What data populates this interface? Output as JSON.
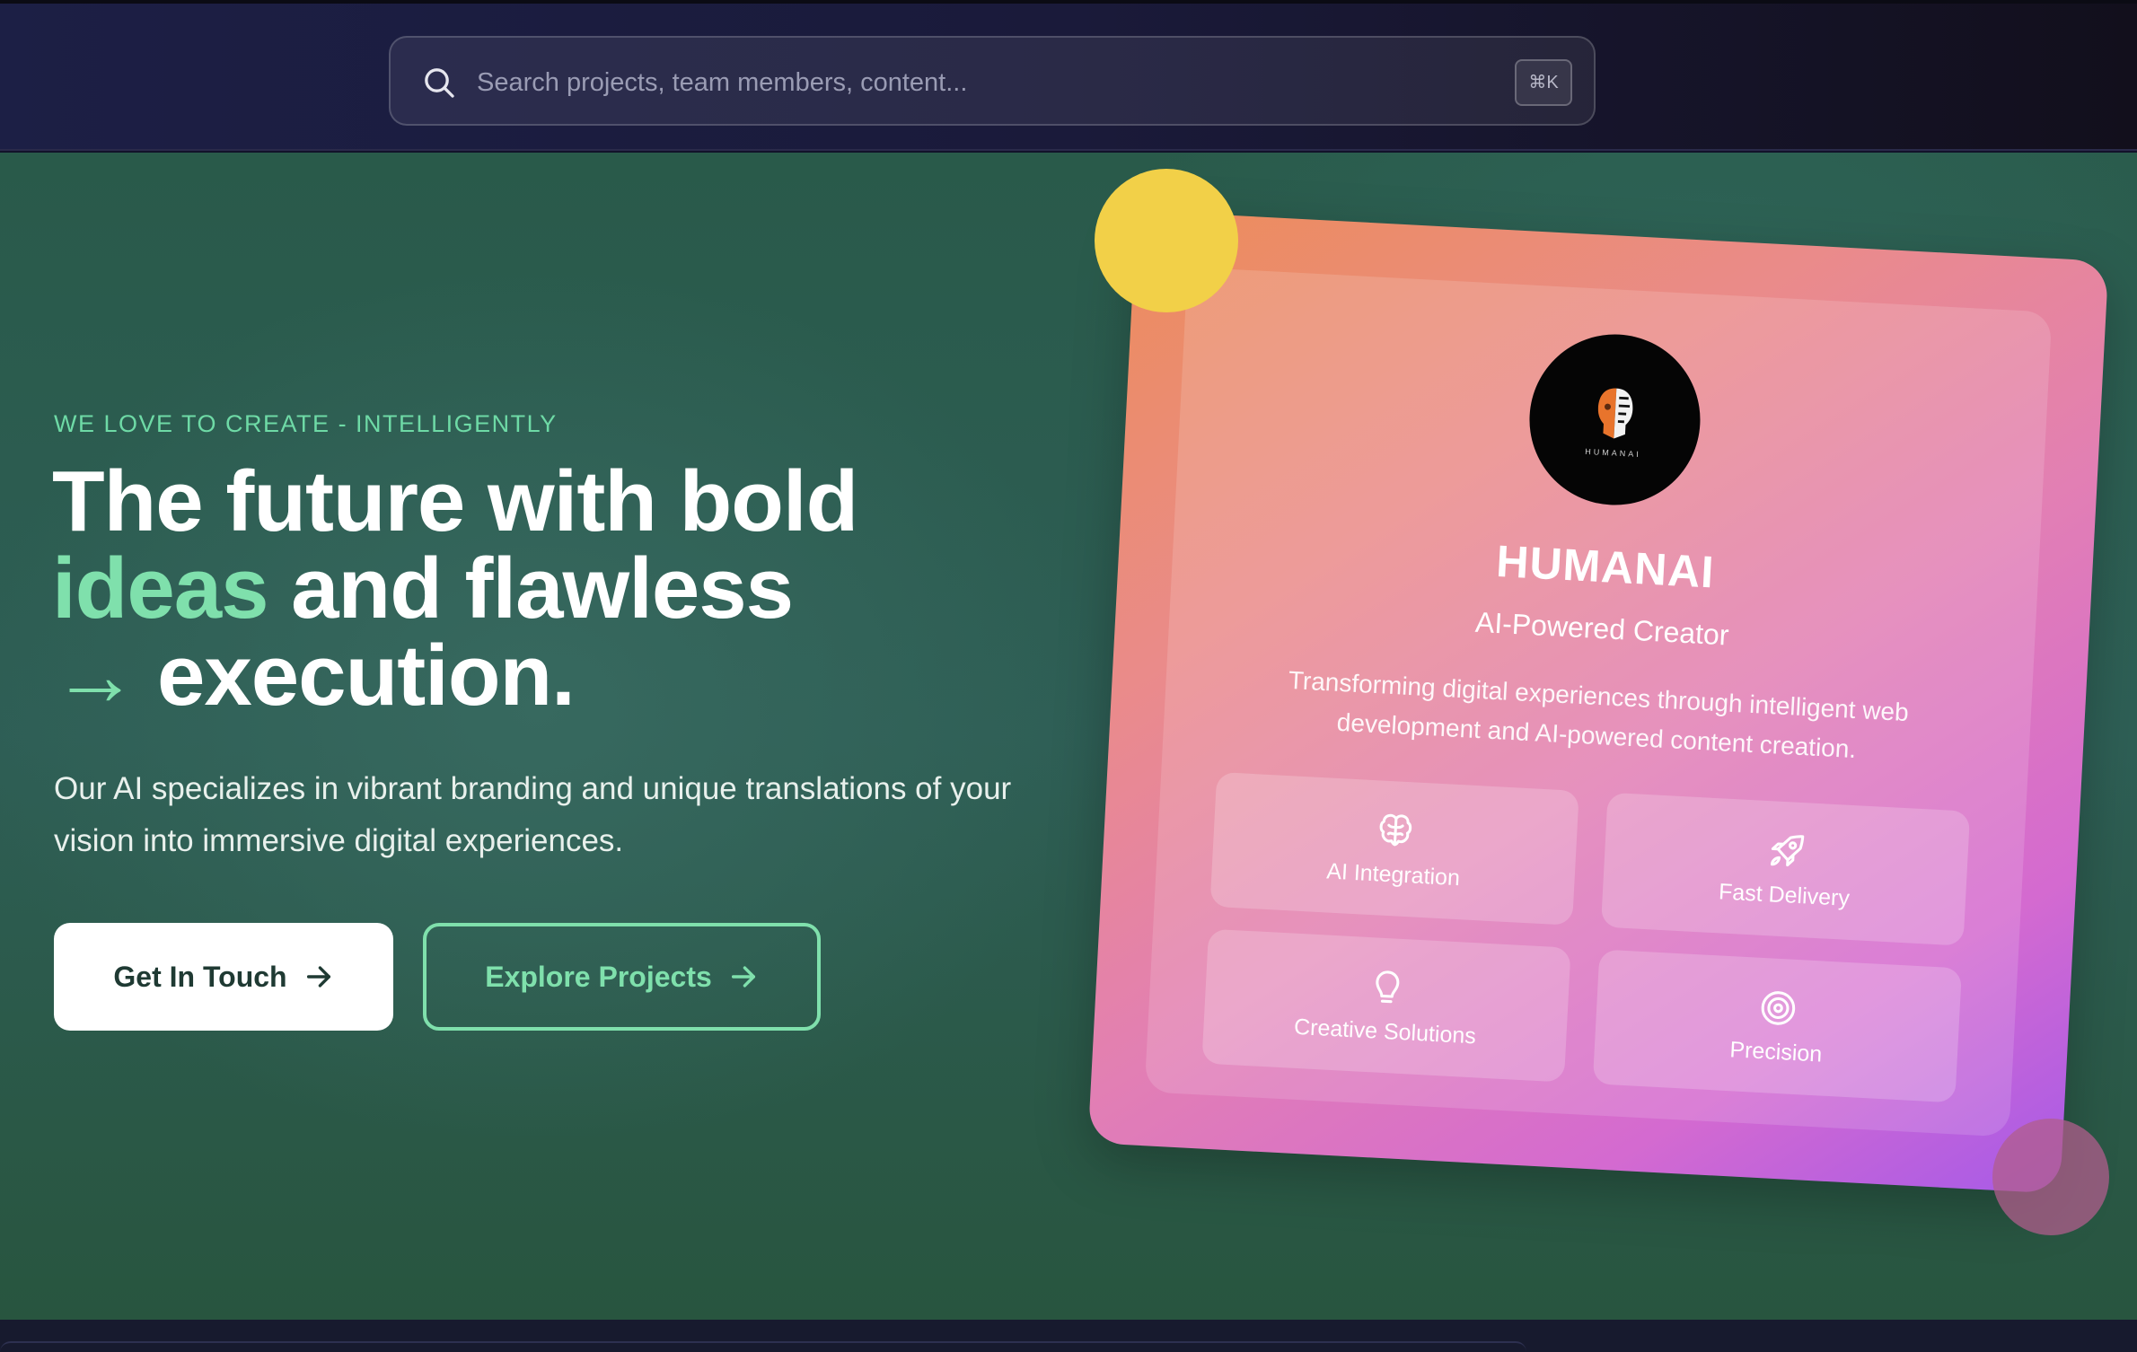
{
  "search": {
    "placeholder": "Search projects, team members, content...",
    "shortcut": "⌘K"
  },
  "hero": {
    "eyebrow": "WE LOVE TO CREATE - INTELLIGENTLY",
    "headline": {
      "line1": "The future with bold",
      "accent_word": "ideas",
      "line2_rest": " and flawless",
      "arrow": "→",
      "line3": "execution."
    },
    "subtext": "Our AI specializes in vibrant branding and unique translations of your vision into immersive digital experiences.",
    "primary_button": "Get In Touch",
    "secondary_button": "Explore Projects"
  },
  "card": {
    "logo_text": "HUMANAI",
    "title": "HUMANAI",
    "subtitle": "AI-Powered Creator",
    "description": "Transforming digital experiences through intelligent web development and AI-powered content creation.",
    "features": [
      {
        "label": "AI Integration",
        "icon": "brain-icon"
      },
      {
        "label": "Fast Delivery",
        "icon": "rocket-icon"
      },
      {
        "label": "Creative Solutions",
        "icon": "lightbulb-icon"
      },
      {
        "label": "Precision",
        "icon": "target-icon"
      }
    ]
  },
  "colors": {
    "accent": "#7fe0ac",
    "yellow_dot": "#f2d048",
    "card_gradient_start": "#ec8d5a",
    "card_gradient_end": "#a65ae8"
  }
}
